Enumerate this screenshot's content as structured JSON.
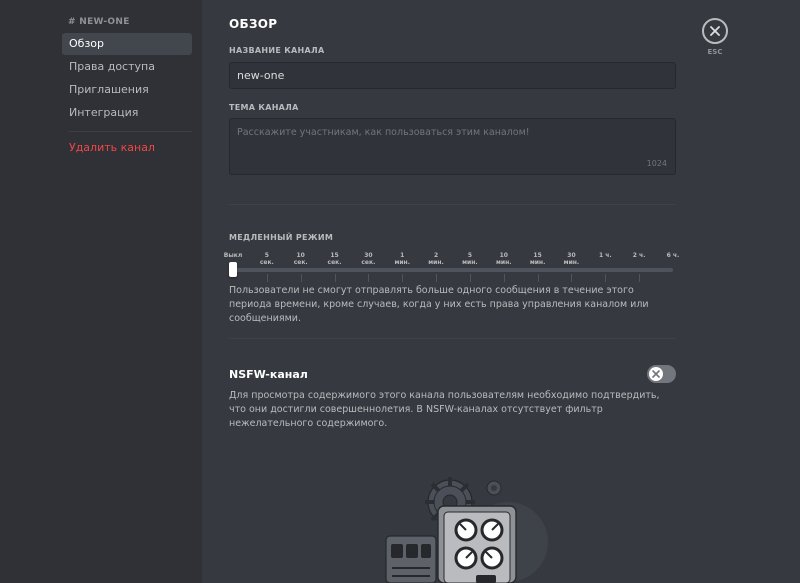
{
  "sidebar": {
    "header": "# NEW-ONE",
    "items": [
      {
        "label": "Обзор",
        "active": true
      },
      {
        "label": "Права доступа"
      },
      {
        "label": "Приглашения"
      },
      {
        "label": "Интеграция"
      }
    ],
    "delete_label": "Удалить канал"
  },
  "main": {
    "title": "ОБЗОР",
    "channel_name_label": "НАЗВАНИЕ КАНАЛА",
    "channel_name_value": "new-one",
    "topic_label": "ТЕМА КАНАЛА",
    "topic_placeholder": "Расскажите участникам, как пользоваться этим каналом!",
    "topic_counter": "1024",
    "slowmode_label": "МЕДЛЕННЫЙ РЕЖИМ",
    "slowmode_ticks": [
      [
        "Выкл"
      ],
      [
        "5",
        "сек."
      ],
      [
        "10",
        "сек."
      ],
      [
        "15",
        "сек."
      ],
      [
        "30",
        "сек."
      ],
      [
        "1",
        "мин."
      ],
      [
        "2",
        "мин."
      ],
      [
        "5",
        "мин."
      ],
      [
        "10",
        "мин."
      ],
      [
        "15",
        "мин."
      ],
      [
        "30",
        "мин."
      ],
      [
        "1 ч."
      ],
      [
        "2 ч."
      ],
      [
        "6 ч."
      ]
    ],
    "slowmode_value_index": 0,
    "slowmode_desc": "Пользователи не смогут отправлять больше одного сообщения в течение этого периода времени, кроме случаев, когда у них есть права управления каналом или сообщениями.",
    "nsfw_title": "NSFW-канал",
    "nsfw_enabled": false,
    "nsfw_desc": "Для просмотра содержимого этого канала пользователям необходимо подтвердить, что они достигли совершеннолетия. В NSFW-каналах отсутствует фильтр нежелательного содержимого."
  },
  "close": {
    "label": "ESC",
    "icon": "close-icon"
  },
  "colors": {
    "background": "#36393f",
    "sidebar": "#2f3136",
    "danger": "#f04747",
    "toggle_off": "#72767d"
  }
}
